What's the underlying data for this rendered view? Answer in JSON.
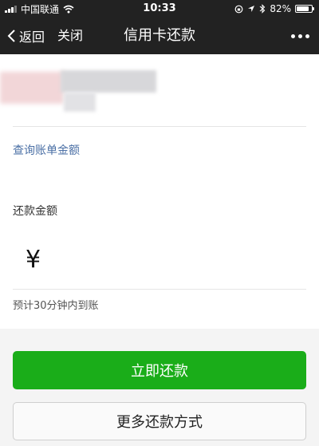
{
  "status_bar": {
    "carrier": "中国联通",
    "time": "10:33",
    "battery_text": "82%",
    "battery_level": 82
  },
  "nav": {
    "back_label": "返回",
    "close_label": "关闭",
    "title": "信用卡还款"
  },
  "card": {
    "query_bill_label": "查询账单金额"
  },
  "amount": {
    "label": "还款金额",
    "currency_symbol": "¥",
    "value": "",
    "eta_text": "预计30分钟内到账"
  },
  "actions": {
    "repay_now_label": "立即还款",
    "more_methods_label": "更多还款方式"
  },
  "colors": {
    "bar_bg": "#222222",
    "primary_green": "#1aad19",
    "link_blue": "#4a6fa5"
  }
}
